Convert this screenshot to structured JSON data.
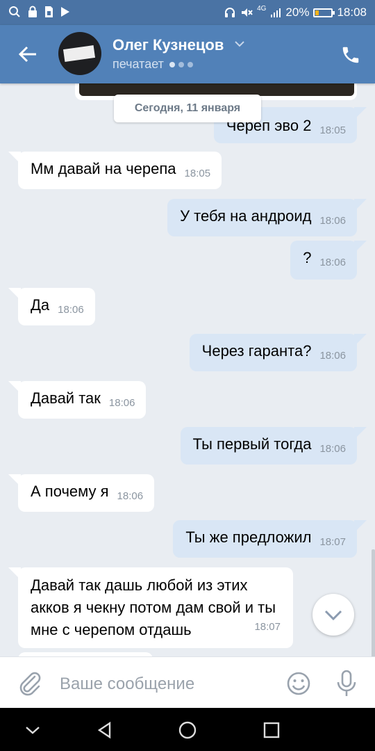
{
  "status_bar": {
    "network": "4G",
    "battery": "20%",
    "battery_level": 0.2,
    "time": "18:08"
  },
  "header": {
    "contact_name": "Олег Кузнецов",
    "status": "печатает"
  },
  "chat": {
    "date_divider": "Сегодня, 11 января",
    "messages": [
      {
        "direction": "out",
        "text": "Череп эво 2",
        "time": "18:05"
      },
      {
        "direction": "in",
        "text": "Мм давай на черепа",
        "time": "18:05"
      },
      {
        "direction": "out",
        "text": "У тебя на андроид",
        "time": "18:06"
      },
      {
        "direction": "out",
        "text": "?",
        "time": "18:06"
      },
      {
        "direction": "in",
        "text": "Да",
        "time": "18:06"
      },
      {
        "direction": "out",
        "text": "Через гаранта?",
        "time": "18:06"
      },
      {
        "direction": "in",
        "text": "Давай так",
        "time": "18:06"
      },
      {
        "direction": "out",
        "text": "Ты первый тогда",
        "time": "18:06"
      },
      {
        "direction": "in",
        "text": "А почему я",
        "time": "18:06"
      },
      {
        "direction": "out",
        "text": "Ты же предложил",
        "time": "18:07"
      },
      {
        "direction": "in",
        "text": "Давай так дашь любой из этих акков я чекну потом дам свой и ты мне с черепом отдашь",
        "time": "18:07"
      }
    ]
  },
  "composer": {
    "placeholder": "Ваше сообщение"
  },
  "colors": {
    "header": "#5181b8",
    "status_bar": "#4a73a4",
    "outgoing_bubble": "#d9e6f5",
    "incoming_bubble": "#ffffff",
    "chat_background": "#e9edf2"
  }
}
